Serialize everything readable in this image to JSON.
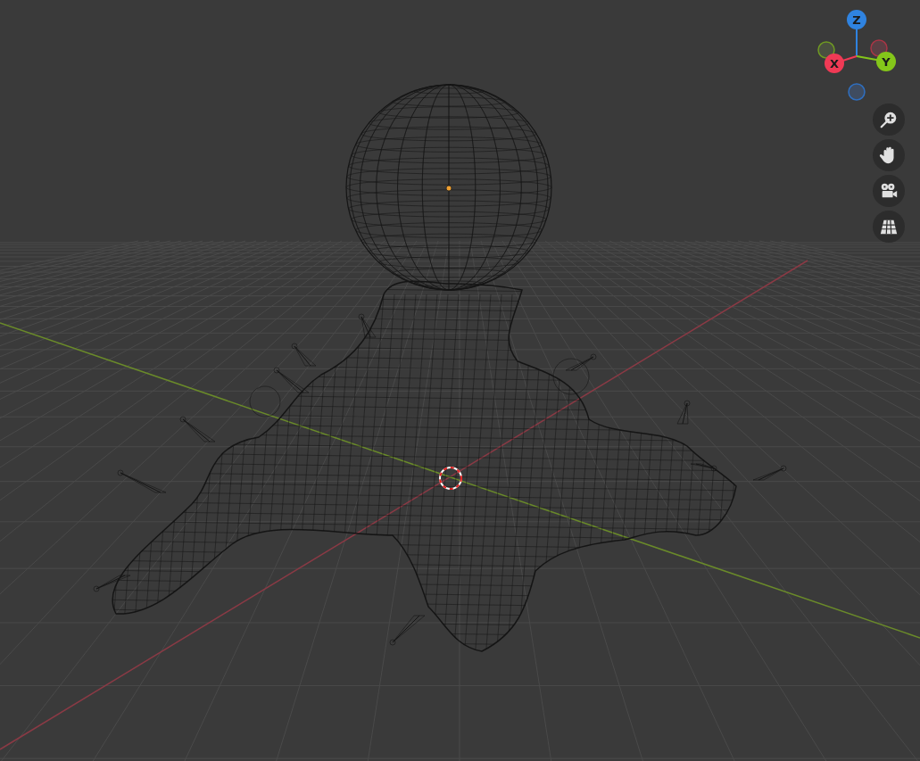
{
  "viewport": {
    "gizmo": {
      "axes": [
        {
          "label": "Z",
          "color": "#2f83e0",
          "kind": "z"
        },
        {
          "label": "X",
          "color": "#f03a55",
          "kind": "x"
        },
        {
          "label": "Y",
          "color": "#84c61a",
          "kind": "y"
        }
      ]
    },
    "tools": [
      {
        "kind": "zoom"
      },
      {
        "kind": "pan"
      },
      {
        "kind": "camera"
      },
      {
        "kind": "grid"
      }
    ]
  }
}
